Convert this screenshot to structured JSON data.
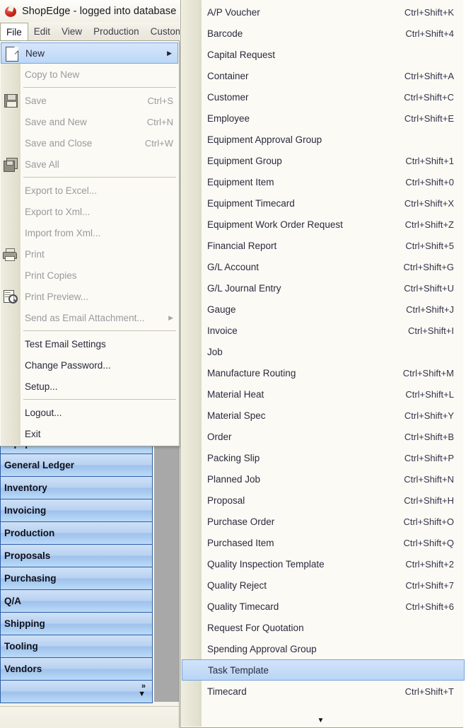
{
  "window": {
    "title": "ShopEdge -  logged into database",
    "app_icon": "shopedge-logo-icon"
  },
  "menubar": {
    "items": [
      {
        "label": "File",
        "active": true
      },
      {
        "label": "Edit",
        "active": false
      },
      {
        "label": "View",
        "active": false
      },
      {
        "label": "Production",
        "active": false
      },
      {
        "label": "Custom",
        "active": false
      }
    ]
  },
  "file_menu": {
    "items": [
      {
        "label": "New",
        "accel": "",
        "icon": "new-page-icon",
        "disabled": false,
        "highlight": true,
        "submenu": true
      },
      {
        "label": "Copy to New",
        "accel": "",
        "icon": "",
        "disabled": true,
        "highlight": false,
        "submenu": false
      },
      {
        "separator": true
      },
      {
        "label": "Save",
        "accel": "Ctrl+S",
        "icon": "save-icon",
        "disabled": true,
        "highlight": false,
        "submenu": false
      },
      {
        "label": "Save and New",
        "accel": "Ctrl+N",
        "icon": "",
        "disabled": true,
        "highlight": false,
        "submenu": false
      },
      {
        "label": "Save and Close",
        "accel": "Ctrl+W",
        "icon": "",
        "disabled": true,
        "highlight": false,
        "submenu": false
      },
      {
        "label": "Save All",
        "accel": "",
        "icon": "save-all-icon",
        "disabled": true,
        "highlight": false,
        "submenu": false
      },
      {
        "separator": true
      },
      {
        "label": "Export to Excel...",
        "accel": "",
        "icon": "",
        "disabled": true,
        "highlight": false,
        "submenu": false
      },
      {
        "label": "Export to Xml...",
        "accel": "",
        "icon": "",
        "disabled": true,
        "highlight": false,
        "submenu": false
      },
      {
        "label": "Import from Xml...",
        "accel": "",
        "icon": "",
        "disabled": true,
        "highlight": false,
        "submenu": false
      },
      {
        "label": "Print",
        "accel": "",
        "icon": "print-icon",
        "disabled": true,
        "highlight": false,
        "submenu": false
      },
      {
        "label": "Print Copies",
        "accel": "",
        "icon": "",
        "disabled": true,
        "highlight": false,
        "submenu": false
      },
      {
        "label": "Print Preview...",
        "accel": "",
        "icon": "print-preview-icon",
        "disabled": true,
        "highlight": false,
        "submenu": false
      },
      {
        "label": "Send as Email Attachment...",
        "accel": "",
        "icon": "",
        "disabled": true,
        "highlight": false,
        "submenu": true
      },
      {
        "separator": true
      },
      {
        "label": "Test Email Settings",
        "accel": "",
        "icon": "",
        "disabled": false,
        "highlight": false,
        "submenu": false
      },
      {
        "label": "Change Password...",
        "accel": "",
        "icon": "",
        "disabled": false,
        "highlight": false,
        "submenu": false
      },
      {
        "label": "Setup...",
        "accel": "",
        "icon": "",
        "disabled": false,
        "highlight": false,
        "submenu": false
      },
      {
        "separator": true
      },
      {
        "label": "Logout...",
        "accel": "",
        "icon": "",
        "disabled": false,
        "highlight": false,
        "submenu": false
      },
      {
        "label": "Exit",
        "accel": "",
        "icon": "",
        "disabled": false,
        "highlight": false,
        "submenu": false
      }
    ]
  },
  "new_submenu": {
    "scroll_down_icon": "scroll-down-arrow-icon",
    "items": [
      {
        "label": "A/P Voucher",
        "accel": "Ctrl+Shift+K",
        "selected": false
      },
      {
        "label": "Barcode",
        "accel": "Ctrl+Shift+4",
        "selected": false
      },
      {
        "label": "Capital Request",
        "accel": "",
        "selected": false
      },
      {
        "label": "Container",
        "accel": "Ctrl+Shift+A",
        "selected": false
      },
      {
        "label": "Customer",
        "accel": "Ctrl+Shift+C",
        "selected": false
      },
      {
        "label": "Employee",
        "accel": "Ctrl+Shift+E",
        "selected": false
      },
      {
        "label": "Equipment Approval Group",
        "accel": "",
        "selected": false
      },
      {
        "label": "Equipment Group",
        "accel": "Ctrl+Shift+1",
        "selected": false
      },
      {
        "label": "Equipment Item",
        "accel": "Ctrl+Shift+0",
        "selected": false
      },
      {
        "label": "Equipment Timecard",
        "accel": "Ctrl+Shift+X",
        "selected": false
      },
      {
        "label": "Equipment Work Order Request",
        "accel": "Ctrl+Shift+Z",
        "selected": false
      },
      {
        "label": "Financial Report",
        "accel": "Ctrl+Shift+5",
        "selected": false
      },
      {
        "label": "G/L Account",
        "accel": "Ctrl+Shift+G",
        "selected": false
      },
      {
        "label": "G/L Journal Entry",
        "accel": "Ctrl+Shift+U",
        "selected": false
      },
      {
        "label": "Gauge",
        "accel": "Ctrl+Shift+J",
        "selected": false
      },
      {
        "label": "Invoice",
        "accel": "Ctrl+Shift+I",
        "selected": false
      },
      {
        "label": "Job",
        "accel": "",
        "selected": false
      },
      {
        "label": "Manufacture Routing",
        "accel": "Ctrl+Shift+M",
        "selected": false
      },
      {
        "label": "Material Heat",
        "accel": "Ctrl+Shift+L",
        "selected": false
      },
      {
        "label": "Material Spec",
        "accel": "Ctrl+Shift+Y",
        "selected": false
      },
      {
        "label": "Order",
        "accel": "Ctrl+Shift+B",
        "selected": false
      },
      {
        "label": "Packing Slip",
        "accel": "Ctrl+Shift+P",
        "selected": false
      },
      {
        "label": "Planned Job",
        "accel": "Ctrl+Shift+N",
        "selected": false
      },
      {
        "label": "Proposal",
        "accel": "Ctrl+Shift+H",
        "selected": false
      },
      {
        "label": "Purchase Order",
        "accel": "Ctrl+Shift+O",
        "selected": false
      },
      {
        "label": "Purchased Item",
        "accel": "Ctrl+Shift+Q",
        "selected": false
      },
      {
        "label": "Quality Inspection Template",
        "accel": "Ctrl+Shift+2",
        "selected": false
      },
      {
        "label": "Quality Reject",
        "accel": "Ctrl+Shift+7",
        "selected": false
      },
      {
        "label": "Quality Timecard",
        "accel": "Ctrl+Shift+6",
        "selected": false
      },
      {
        "label": "Request For Quotation",
        "accel": "",
        "selected": false
      },
      {
        "label": "Spending Approval Group",
        "accel": "",
        "selected": false
      },
      {
        "label": "Task Template",
        "accel": "",
        "selected": true
      },
      {
        "label": "Timecard",
        "accel": "Ctrl+Shift+T",
        "selected": false
      }
    ]
  },
  "sidebar": {
    "items": [
      {
        "label": "Equipment"
      },
      {
        "label": "General Ledger"
      },
      {
        "label": "Inventory"
      },
      {
        "label": "Invoicing"
      },
      {
        "label": "Production"
      },
      {
        "label": "Proposals"
      },
      {
        "label": "Purchasing"
      },
      {
        "label": "Q/A"
      },
      {
        "label": "Shipping"
      },
      {
        "label": "Tooling"
      },
      {
        "label": "Vendors"
      }
    ],
    "overflow": {
      "chevrons_icon": "double-chevron-right-icon",
      "caret_icon": "caret-down-icon",
      "chevrons": "»",
      "caret": "▼"
    }
  },
  "colors": {
    "menu_bg": "#fbfaf5",
    "menu_gutter": "#e6e4d4",
    "highlight_border": "#7ba6dd",
    "nav_border": "#2f5fa8",
    "filler_gray": "#a8a8a8"
  }
}
